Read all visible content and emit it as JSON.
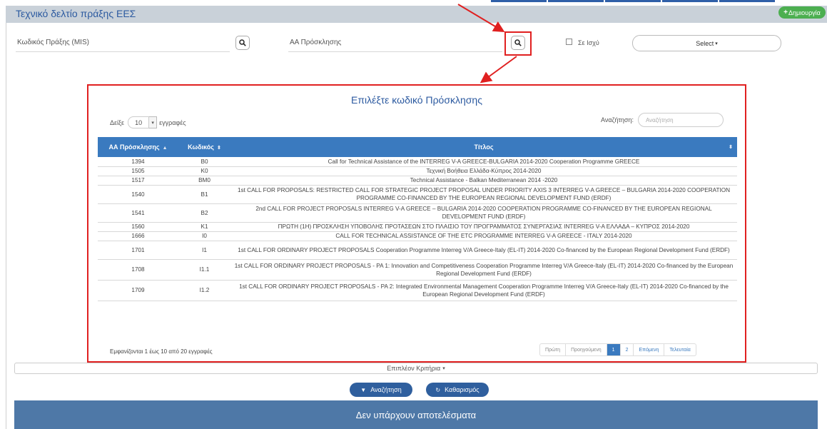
{
  "header": {
    "title": "Τεχνικό δελτίο πράξης ΕΕΣ",
    "create_label": "Δημιουργία"
  },
  "filters": {
    "mis_label": "Κωδικός Πράξης (MIS)",
    "call_label": "ΑΑ Πρόσκλησης",
    "in_force_label": "Σε Ισχύ",
    "select_label": "Select"
  },
  "modal": {
    "title": "Επιλέξτε κωδικό Πρόσκλησης",
    "show_label": "Δείξε",
    "length_value": "10",
    "entries_label": "εγγραφές",
    "search_label": "Αναζήτηση:",
    "search_placeholder": "Αναζήτηση",
    "columns": [
      "ΑΑ Πρόσκλησης",
      "Κωδικός",
      "Τίτλος"
    ],
    "rows": [
      {
        "aa": "1394",
        "code": "B0",
        "title": "Call for Technical Assistance of the INTERREG V-A GREECE-BULGARIA 2014-2020 Cooperation Programme GREECE"
      },
      {
        "aa": "1505",
        "code": "K0",
        "title": "Τεχνική Βοήθεια Ελλάδα-Κύπρος 2014-2020"
      },
      {
        "aa": "1517",
        "code": "BM0",
        "title": "Technical Assistance - Balkan Mediterranean 2014 -2020"
      },
      {
        "aa": "1540",
        "code": "B1",
        "title": "1st CALL FOR PROPOSALS: RESTRICTED CALL FOR STRATEGIC PROJECT PROPOSAL UNDER PRIORITY AXIS 3 INTERREG V-A GREECE – BULGARIA 2014-2020 COOPERATION PROGRAMME CO-FINANCED BY THE EUROPEAN REGIONAL DEVELOPMENT FUND (ERDF)"
      },
      {
        "aa": "1541",
        "code": "B2",
        "title": "2nd CALL FOR PROJECT PROPOSALS INTERREG V-A GREECE – BULGARIA 2014-2020 COOPERATION PROGRAMME CO-FINANCED BY THE EUROPEAN REGIONAL DEVELOPMENT FUND (ERDF)"
      },
      {
        "aa": "1560",
        "code": "K1",
        "title": "ΠΡΩΤΗ (1Η) ΠΡΟΣΚΛΗΣΗ ΥΠΟΒΟΛΗΣ ΠΡΟΤΑΣΕΩΝ ΣΤΟ ΠΛΑΙΣΙΟ ΤΟΥ ΠΡΟΓΡΑΜΜΑΤΟΣ ΣΥΝΕΡΓΑΣΙΑΣ INTERREG V-A ΕΛΛΑΔΑ – ΚΥΠΡΟΣ 2014-2020"
      },
      {
        "aa": "1666",
        "code": "I0",
        "title": "CALL FOR TECHNICAL ASSISTANCE OF THE ETC PROGRAMME INTERREG V-A GREECE - ITALY 2014-2020"
      },
      {
        "aa": "1701",
        "code": "I1",
        "title": "1st CALL FOR ORDINARY PROJECT PROPOSALS Cooperation Programme Interreg V/A Greece-Italy (EL-IT) 2014-2020 Co-financed by the European Regional Development Fund (ERDF)"
      },
      {
        "aa": "1708",
        "code": "I1.1",
        "title": "1st CALL FOR ORDINARY PROJECT PROPOSALS - PA 1: Innovation and Competitiveness Cooperation Programme Interreg V/A Greece-Italy (EL-IT) 2014-2020 Co-financed by the European Regional Development Fund (ERDF)"
      },
      {
        "aa": "1709",
        "code": "I1.2",
        "title": "1st CALL FOR ORDINARY PROJECT PROPOSALS - PA 2: Integrated Environmental Management Cooperation Programme Interreg V/A Greece-Italy (EL-IT) 2014-2020 Co-financed by the European Regional Development Fund (ERDF)"
      }
    ],
    "info": "Εμφανίζονται 1 έως 10 από 20 εγγραφές",
    "pager": {
      "first": "Πρώτη",
      "prev": "Προηγούμενη",
      "page1": "1",
      "page2": "2",
      "next": "Επόμενη",
      "last": "Τελευταία"
    }
  },
  "more_criteria": "Επιπλέον Κριτήρια",
  "buttons": {
    "search": "Αναζήτηση",
    "clear": "Καθαρισμός"
  },
  "no_results": "Δεν υπάρχουν αποτελέσματα",
  "colors": {
    "accent": "#3a7abf",
    "highlight": "#e02020",
    "create": "#4caf50"
  }
}
